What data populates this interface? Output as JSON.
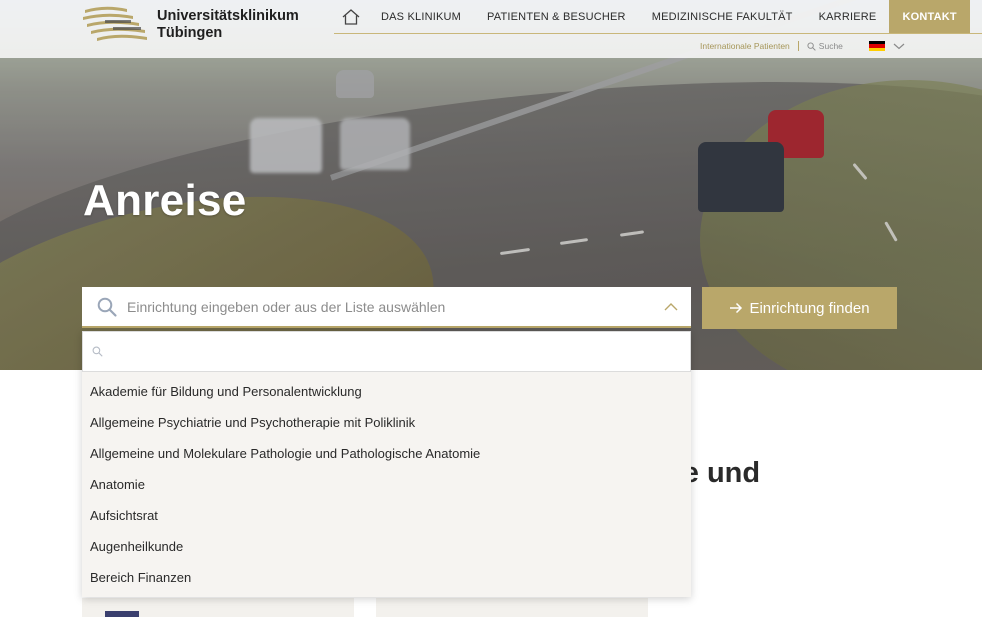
{
  "header": {
    "logo_line1": "Universitätsklinikum",
    "logo_line2": "Tübingen",
    "nav": [
      {
        "label": "DAS KLINIKUM"
      },
      {
        "label": "PATIENTEN & BESUCHER"
      },
      {
        "label": "MEDIZINISCHE FAKULTÄT"
      },
      {
        "label": "KARRIERE"
      },
      {
        "label": "KONTAKT",
        "active": true
      }
    ],
    "subnav": {
      "international": "Internationale Patienten",
      "search": "Suche"
    },
    "colors": {
      "accent": "#b9a76a"
    }
  },
  "hero": {
    "title": "Anreise"
  },
  "search": {
    "placeholder": "Einrichtung eingeben oder aus der Liste auswählen",
    "button_label": "Einrichtung finden"
  },
  "dropdown": {
    "filter_value": "",
    "items": [
      "Akademie für Bildung und Personalentwicklung",
      "Allgemeine Psychiatrie und Psychotherapie mit Poliklinik",
      "Allgemeine und Molekulare Pathologie und Pathologische Anatomie",
      "Anatomie",
      "Aufsichtsrat",
      "Augenheilkunde",
      "Bereich Finanzen"
    ]
  },
  "main": {
    "heading_fragment": "gie und"
  }
}
